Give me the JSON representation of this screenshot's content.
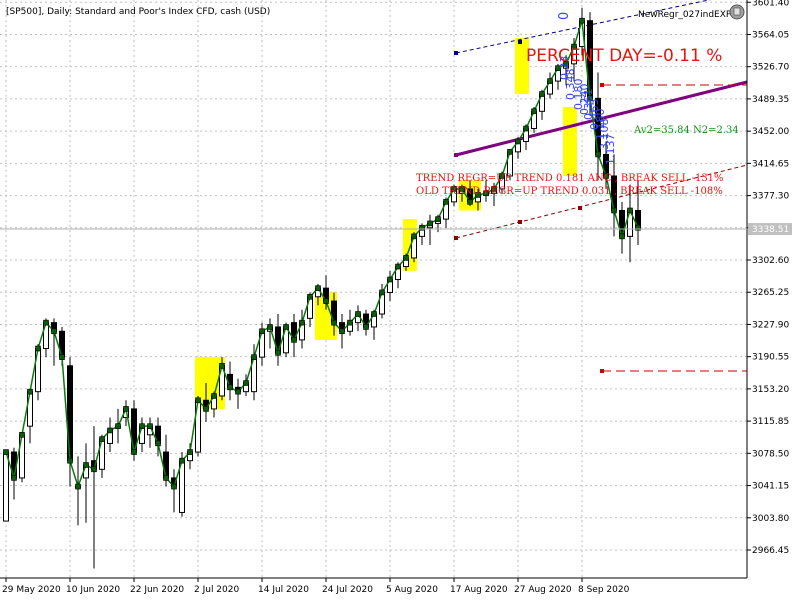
{
  "header": {
    "symbol_info": "[SP500], Daily:  Standard and Poor's Index CFD, cash (USD)",
    "indicator_name": "NewRegr_027indEXP"
  },
  "annotations": {
    "percent_day": "PERCENT DAY=-0.11 %",
    "av_stats": "Av2=35.84  N2=2.34",
    "trend_regr": "TREND REGR=UP TREND  0.181 ANC , BREAK SELL -131%",
    "old_trend_regr": "OLD TREND REGR=UP TREND  0.031 , BREAK SELL -108%",
    "top_zero": "0",
    "vertical_labels": [
      "0.23",
      "0.348",
      "0.180",
      "0.240",
      "0.361",
      "0.465",
      "1.180",
      "3.108",
      "1.137"
    ]
  },
  "colors": {
    "candle_bull": "#ffffff",
    "candle_bear": "#000000",
    "close_line": "#0a7a0a",
    "highlight": "#ffff00",
    "regression_purple": "#800080",
    "channel_navy": "#000080",
    "channel_dark_red": "#8b0000",
    "dashed_red": "#cc0000",
    "annotation_red": "#ee1111",
    "annotation_blue": "#3344ee",
    "annotation_green": "#1a8c1a",
    "grid": "#c0c0c0"
  },
  "chart_data": {
    "type": "candlestick",
    "title": "[SP500], Daily:  Standard and Poor's Index CFD, cash (USD)",
    "ylim": [
      2934,
      3604
    ],
    "price_ticks": [
      "3601.40",
      "3564.05",
      "3526.70",
      "3489.35",
      "3452.00",
      "3414.65",
      "3377.30",
      "3339.95",
      "3302.60",
      "3265.25",
      "3227.90",
      "3190.55",
      "3153.20",
      "3115.85",
      "3078.50",
      "3041.15",
      "3003.80",
      "2966.45"
    ],
    "current_price": "3338.51",
    "date_labels": [
      "29 May 2020",
      "10 Jun 2020",
      "22 Jun 2020",
      "2 Jul 2020",
      "14 Jul 2020",
      "24 Jul 2020",
      "5 Aug 2020",
      "17 Aug 2020",
      "27 Aug 2020",
      "8 Sep 2020"
    ],
    "date_label_bars": [
      0,
      8,
      16,
      24,
      32,
      40,
      48,
      56,
      64,
      72
    ],
    "first_bar_x": 6,
    "bar_spacing": 8,
    "candles": [
      [
        3000,
        3065,
        3010,
        3080
      ],
      [
        3080,
        3085,
        3025,
        3050
      ],
      [
        3050,
        3085,
        3045,
        3100
      ],
      [
        3110,
        3150,
        3090,
        3150
      ],
      [
        3150,
        3205,
        3140,
        3200
      ],
      [
        3200,
        3235,
        3190,
        3230
      ],
      [
        3230,
        3235,
        3180,
        3220
      ],
      [
        3220,
        3225,
        3180,
        3190
      ],
      [
        3180,
        3190,
        3040,
        3070
      ],
      [
        3040,
        3075,
        2995,
        3040
      ],
      [
        3050,
        3090,
        2998,
        3065
      ],
      [
        3070,
        3110,
        2945,
        3060
      ],
      [
        3060,
        3100,
        3050,
        3095
      ],
      [
        3090,
        3120,
        3080,
        3105
      ],
      [
        3110,
        3130,
        3090,
        3110
      ],
      [
        3120,
        3140,
        3110,
        3130
      ],
      [
        3130,
        3140,
        3070,
        3080
      ],
      [
        3090,
        3120,
        3080,
        3110
      ],
      [
        3100,
        3120,
        3085,
        3110
      ],
      [
        3110,
        3120,
        3075,
        3090
      ],
      [
        3080,
        3100,
        3040,
        3050
      ],
      [
        3050,
        3060,
        3010,
        3040
      ],
      [
        3010,
        3080,
        3005,
        3070
      ],
      [
        3070,
        3090,
        3060,
        3080
      ],
      [
        3080,
        3145,
        3075,
        3140
      ],
      [
        3140,
        3160,
        3115,
        3130
      ],
      [
        3130,
        3150,
        3120,
        3145
      ],
      [
        3145,
        3190,
        3140,
        3180
      ],
      [
        3170,
        3185,
        3140,
        3155
      ],
      [
        3155,
        3165,
        3130,
        3150
      ],
      [
        3150,
        3170,
        3145,
        3160
      ],
      [
        3150,
        3205,
        3140,
        3190
      ],
      [
        3190,
        3230,
        3180,
        3220
      ],
      [
        3220,
        3235,
        3200,
        3225
      ],
      [
        3225,
        3240,
        3180,
        3195
      ],
      [
        3195,
        3230,
        3190,
        3225
      ],
      [
        3230,
        3240,
        3190,
        3210
      ],
      [
        3210,
        3245,
        3200,
        3230
      ],
      [
        3235,
        3265,
        3225,
        3260
      ],
      [
        3260,
        3275,
        3250,
        3270
      ],
      [
        3270,
        3285,
        3245,
        3255
      ],
      [
        3255,
        3265,
        3215,
        3230
      ],
      [
        3230,
        3240,
        3200,
        3220
      ],
      [
        3220,
        3245,
        3215,
        3230
      ],
      [
        3230,
        3250,
        3220,
        3240
      ],
      [
        3240,
        3245,
        3215,
        3225
      ],
      [
        3225,
        3245,
        3210,
        3240
      ],
      [
        3240,
        3275,
        3235,
        3265
      ],
      [
        3265,
        3290,
        3255,
        3280
      ],
      [
        3280,
        3300,
        3270,
        3295
      ],
      [
        3295,
        3310,
        3290,
        3305
      ],
      [
        3305,
        3335,
        3300,
        3330
      ],
      [
        3330,
        3345,
        3320,
        3340
      ],
      [
        3340,
        3355,
        3320,
        3345
      ],
      [
        3345,
        3355,
        3335,
        3350
      ],
      [
        3350,
        3375,
        3340,
        3370
      ],
      [
        3370,
        3390,
        3365,
        3385
      ],
      [
        3380,
        3390,
        3370,
        3385
      ],
      [
        3385,
        3395,
        3365,
        3370
      ],
      [
        3370,
        3385,
        3360,
        3378
      ],
      [
        3378,
        3395,
        3370,
        3380
      ],
      [
        3380,
        3392,
        3365,
        3385
      ],
      [
        3385,
        3405,
        3380,
        3400
      ],
      [
        3400,
        3430,
        3395,
        3428
      ],
      [
        3428,
        3445,
        3420,
        3440
      ],
      [
        3440,
        3460,
        3430,
        3455
      ],
      [
        3455,
        3480,
        3450,
        3475
      ],
      [
        3475,
        3500,
        3465,
        3495
      ],
      [
        3495,
        3520,
        3490,
        3510
      ],
      [
        3510,
        3530,
        3500,
        3525
      ],
      [
        3525,
        3540,
        3505,
        3530
      ],
      [
        3530,
        3560,
        3510,
        3550
      ],
      [
        3550,
        3595,
        3540,
        3580
      ],
      [
        3580,
        3590,
        3470,
        3490
      ],
      [
        3490,
        3520,
        3395,
        3425
      ],
      [
        3425,
        3440,
        3385,
        3400
      ],
      [
        3400,
        3425,
        3330,
        3360
      ],
      [
        3360,
        3370,
        3310,
        3330
      ],
      [
        3330,
        3390,
        3300,
        3360
      ],
      [
        3360,
        3395,
        3320,
        3340
      ]
    ]
  }
}
